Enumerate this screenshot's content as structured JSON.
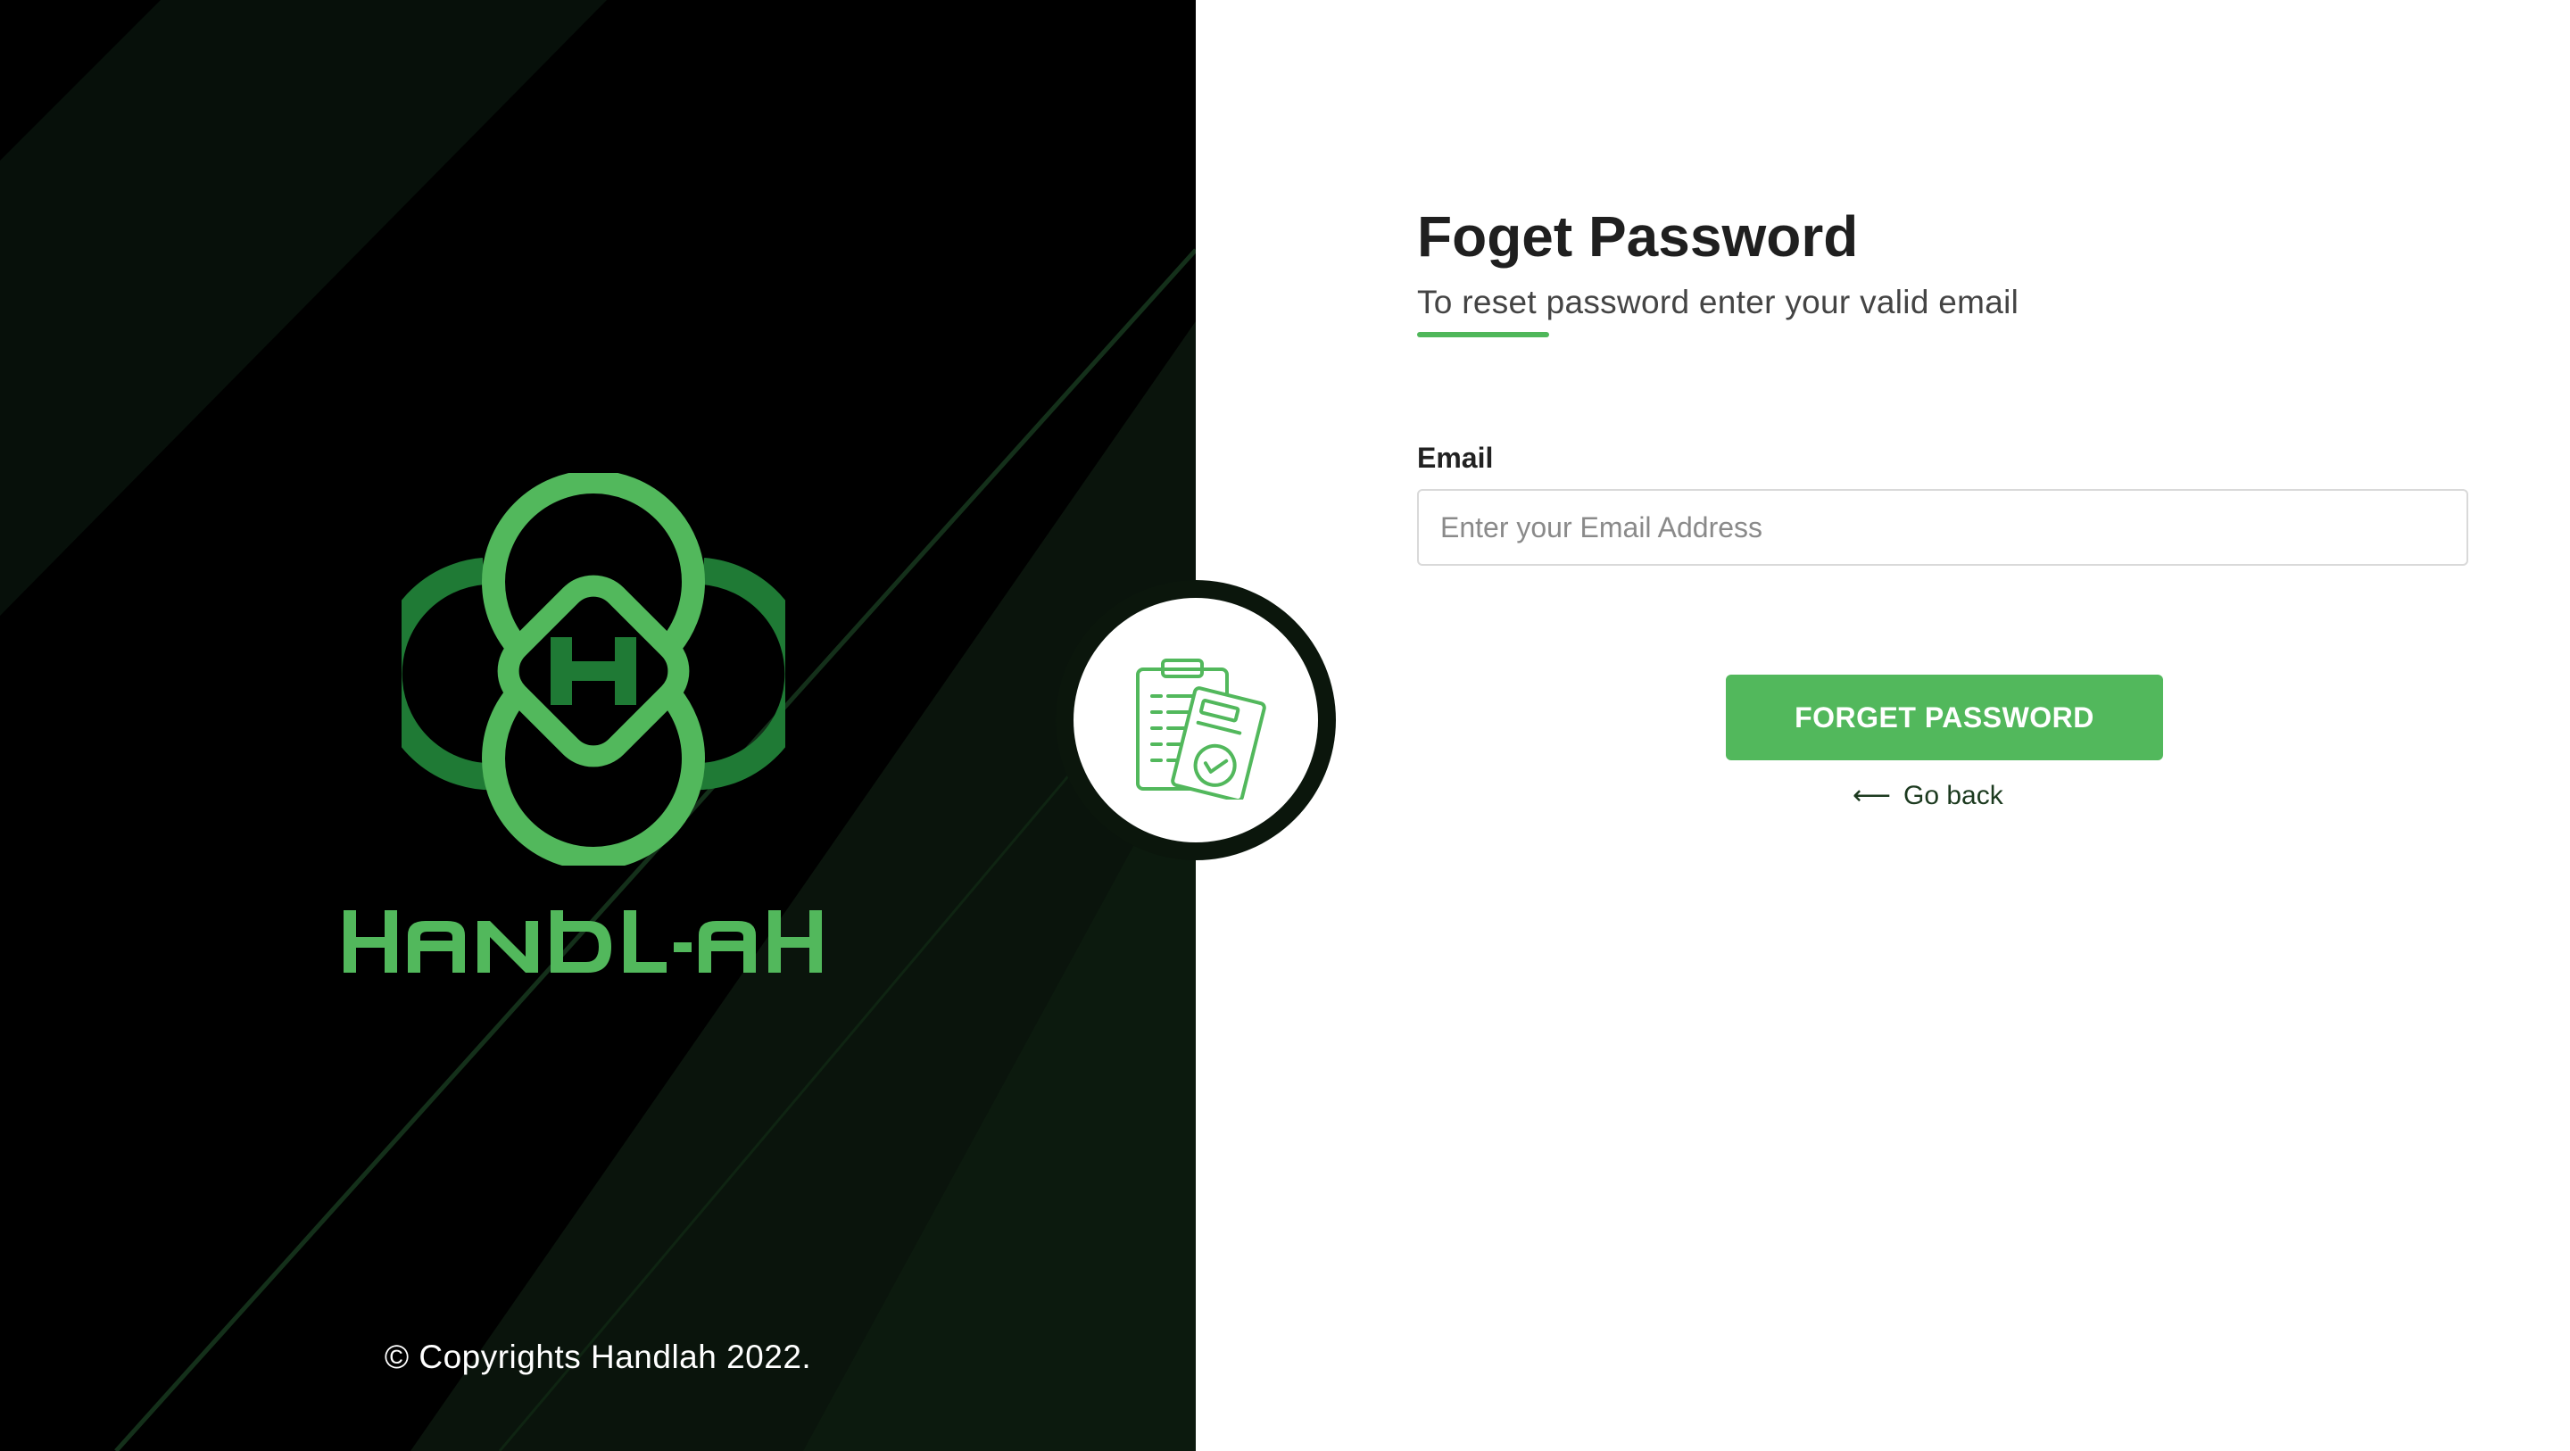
{
  "brand": {
    "name": "HANDL-AH",
    "copyright": "© Copyrights Handlah 2022.",
    "logo_icon": "handlah-knot-logo-icon",
    "colors": {
      "primary": "#52b85c",
      "dark_green": "#1f7a35",
      "panel_bg": "#000000"
    }
  },
  "badge": {
    "icon": "clipboard-check-icon"
  },
  "form": {
    "title": "Foget Password",
    "subtitle": "To reset password enter your valid email",
    "email_label": "Email",
    "email_placeholder": "Enter your Email Address",
    "email_value": "",
    "submit_label": "FORGET PASSWORD",
    "back_label": "Go back",
    "back_icon": "arrow-left-icon"
  }
}
